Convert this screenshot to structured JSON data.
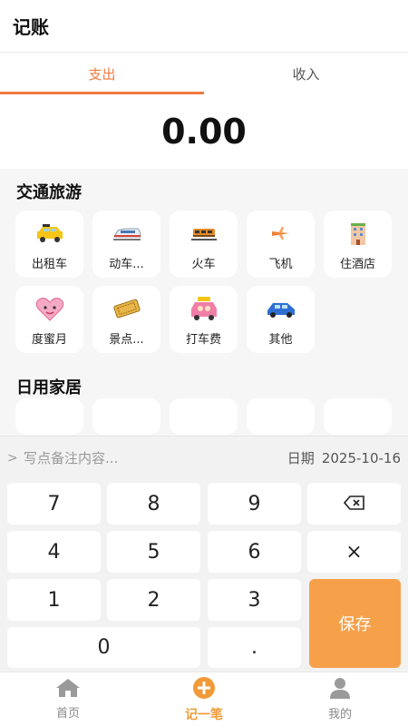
{
  "header": {
    "title": "记账"
  },
  "tabs": [
    {
      "label": "支出",
      "active": true
    },
    {
      "label": "收入",
      "active": false
    }
  ],
  "amount": "0.00",
  "sections": [
    {
      "title": "交通旅游",
      "items": [
        {
          "label": "出租车",
          "icon": "taxi-icon"
        },
        {
          "label": "动车...",
          "icon": "bullet-train-icon"
        },
        {
          "label": "火车",
          "icon": "train-icon"
        },
        {
          "label": "飞机",
          "icon": "airplane-icon"
        },
        {
          "label": "住酒店",
          "icon": "hotel-icon"
        },
        {
          "label": "度蜜月",
          "icon": "honeymoon-heart-icon"
        },
        {
          "label": "景点...",
          "icon": "ticket-icon"
        },
        {
          "label": "打车费",
          "icon": "ride-hailing-car-icon"
        },
        {
          "label": "其他",
          "icon": "blue-car-icon"
        }
      ]
    },
    {
      "title": "日用家居"
    }
  ],
  "note_bar": {
    "placeholder": "写点备注内容...",
    "date_label": "日期",
    "date_value": "2025-10-16"
  },
  "keypad": {
    "keys": [
      "7",
      "8",
      "9",
      "4",
      "5",
      "6",
      "1",
      "2",
      "3",
      "0",
      "."
    ],
    "multiply": "×",
    "backspace_icon": "backspace-icon",
    "save": "保存"
  },
  "bottom_nav": [
    {
      "label": "首页",
      "icon": "home-icon",
      "active": false
    },
    {
      "label": "记一笔",
      "icon": "plus-circle-icon",
      "active": true
    },
    {
      "label": "我的",
      "icon": "user-icon",
      "active": false
    }
  ],
  "colors": {
    "accent": "#f07b3f",
    "save": "#f7a04a",
    "nav_active": "#f29a38"
  }
}
